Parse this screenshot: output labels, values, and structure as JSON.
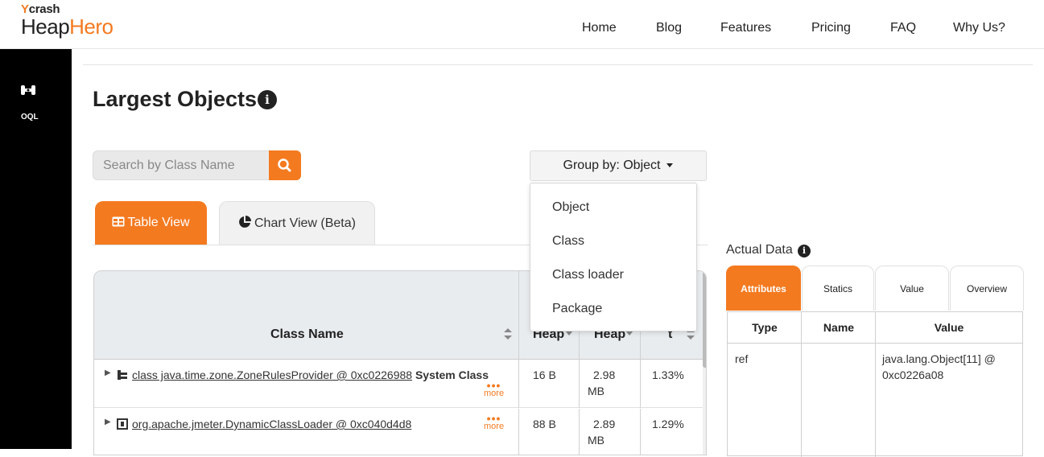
{
  "brand": {
    "ycrash": "crash",
    "heap": "Heap",
    "hero": "Hero"
  },
  "nav": [
    {
      "label": "Home"
    },
    {
      "label": "Blog"
    },
    {
      "label": "Features"
    },
    {
      "label": "Pricing"
    },
    {
      "label": "FAQ"
    },
    {
      "label": "Why Us?"
    }
  ],
  "sidebar": {
    "oql_label": "OQL"
  },
  "page": {
    "title": "Largest Objects"
  },
  "search": {
    "placeholder": "Search by Class Name"
  },
  "group_by": {
    "label": "Group by: Object",
    "options": [
      "Object",
      "Class",
      "Class loader",
      "Package"
    ]
  },
  "view_tabs": {
    "table": "Table View",
    "chart": "Chart View (Beta)"
  },
  "table": {
    "headers": {
      "class_name": "Class Name",
      "shallow": "Heap",
      "retained": "Heap",
      "percent": "t"
    },
    "rows": [
      {
        "class_link": "class java.time.zone.ZoneRulesProvider @ 0xc0226988",
        "suffix": "System Class",
        "shallow": "16 B",
        "retained_num": "2.98",
        "retained_unit": "MB",
        "percent": "1.33%",
        "more": "more"
      },
      {
        "class_link": "org.apache.jmeter.DynamicClassLoader @ 0xc040d4d8",
        "suffix": "",
        "shallow": "88 B",
        "retained_num": "2.89",
        "retained_unit": "MB",
        "percent": "1.29%",
        "more": "more"
      }
    ]
  },
  "actual_data": {
    "label": "Actual Data",
    "tabs": [
      "Attributes",
      "Statics",
      "Value",
      "Overview"
    ],
    "headers": [
      "Type",
      "Name",
      "Value"
    ],
    "row": {
      "type": "ref",
      "name": "",
      "value_line1": "java.lang.Object[11] @",
      "value_line2": "0xc0226a08"
    }
  },
  "colors": {
    "accent": "#f47a20",
    "sidebar": "#000000",
    "header_bg": "#e8ecef"
  }
}
